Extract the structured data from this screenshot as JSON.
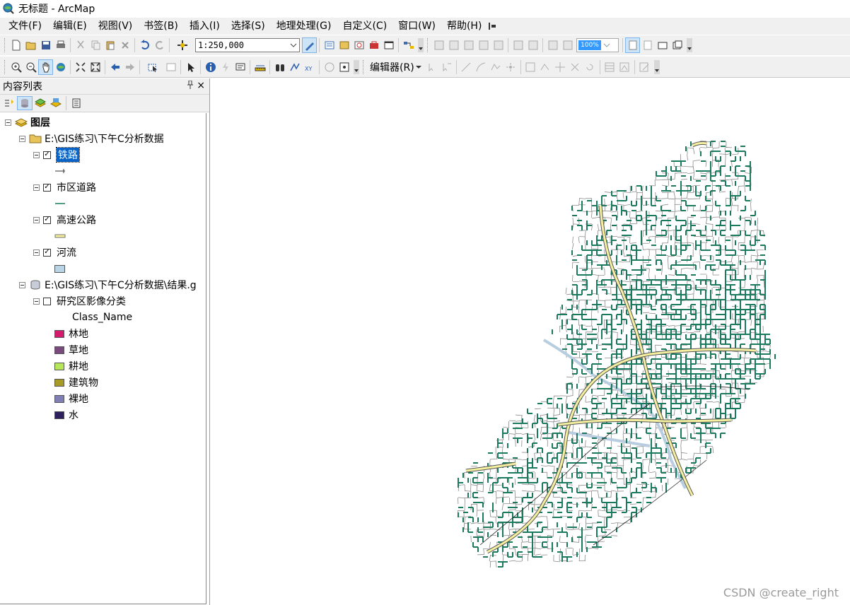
{
  "window": {
    "title": "无标题 - ArcMap"
  },
  "menubar": [
    "文件(F)",
    "编辑(E)",
    "视图(V)",
    "书签(B)",
    "插入(I)",
    "选择(S)",
    "地理处理(G)",
    "自定义(C)",
    "窗口(W)",
    "帮助(H)"
  ],
  "toolbar": {
    "scale": "1:250,000",
    "editor_label": "编辑器(R)",
    "zoom_value": "100%"
  },
  "toc": {
    "title": "内容列表",
    "pin_glyph": "ᵖ",
    "close_glyph": "×",
    "root": "图层",
    "group1": "E:\\GIS练习\\下午C分析数据",
    "layers": [
      {
        "name": "铁路",
        "checked": true,
        "selected": true,
        "symbol": "railway"
      },
      {
        "name": "市区道路",
        "checked": true,
        "selected": false,
        "symbol": "line-green"
      },
      {
        "name": "高速公路",
        "checked": true,
        "selected": false,
        "symbol": "double-yellow"
      },
      {
        "name": "河流",
        "checked": true,
        "selected": false,
        "symbol": "fill-lightblue"
      }
    ],
    "group2": "E:\\GIS练习\\下午C分析数据\\结果.g",
    "raster_layer": "研究区影像分类",
    "raster_checked": false,
    "classify_field": "Class_Name",
    "classes": [
      {
        "label": "林地",
        "color": "#d41a6b"
      },
      {
        "label": "草地",
        "color": "#7a4a7e"
      },
      {
        "label": "耕地",
        "color": "#b8e65a"
      },
      {
        "label": "建筑物",
        "color": "#a89a24"
      },
      {
        "label": "裸地",
        "color": "#7f7fb4"
      },
      {
        "label": "水",
        "color": "#2e1f5e"
      }
    ]
  },
  "map": {
    "colors": {
      "roads": "#1a7a5e",
      "outline": "#8a8a8a",
      "river": "#b9cde0",
      "highway_fill": "#f5f0a0",
      "highway_edge": "#555555"
    }
  },
  "watermark": "CSDN @create_right"
}
